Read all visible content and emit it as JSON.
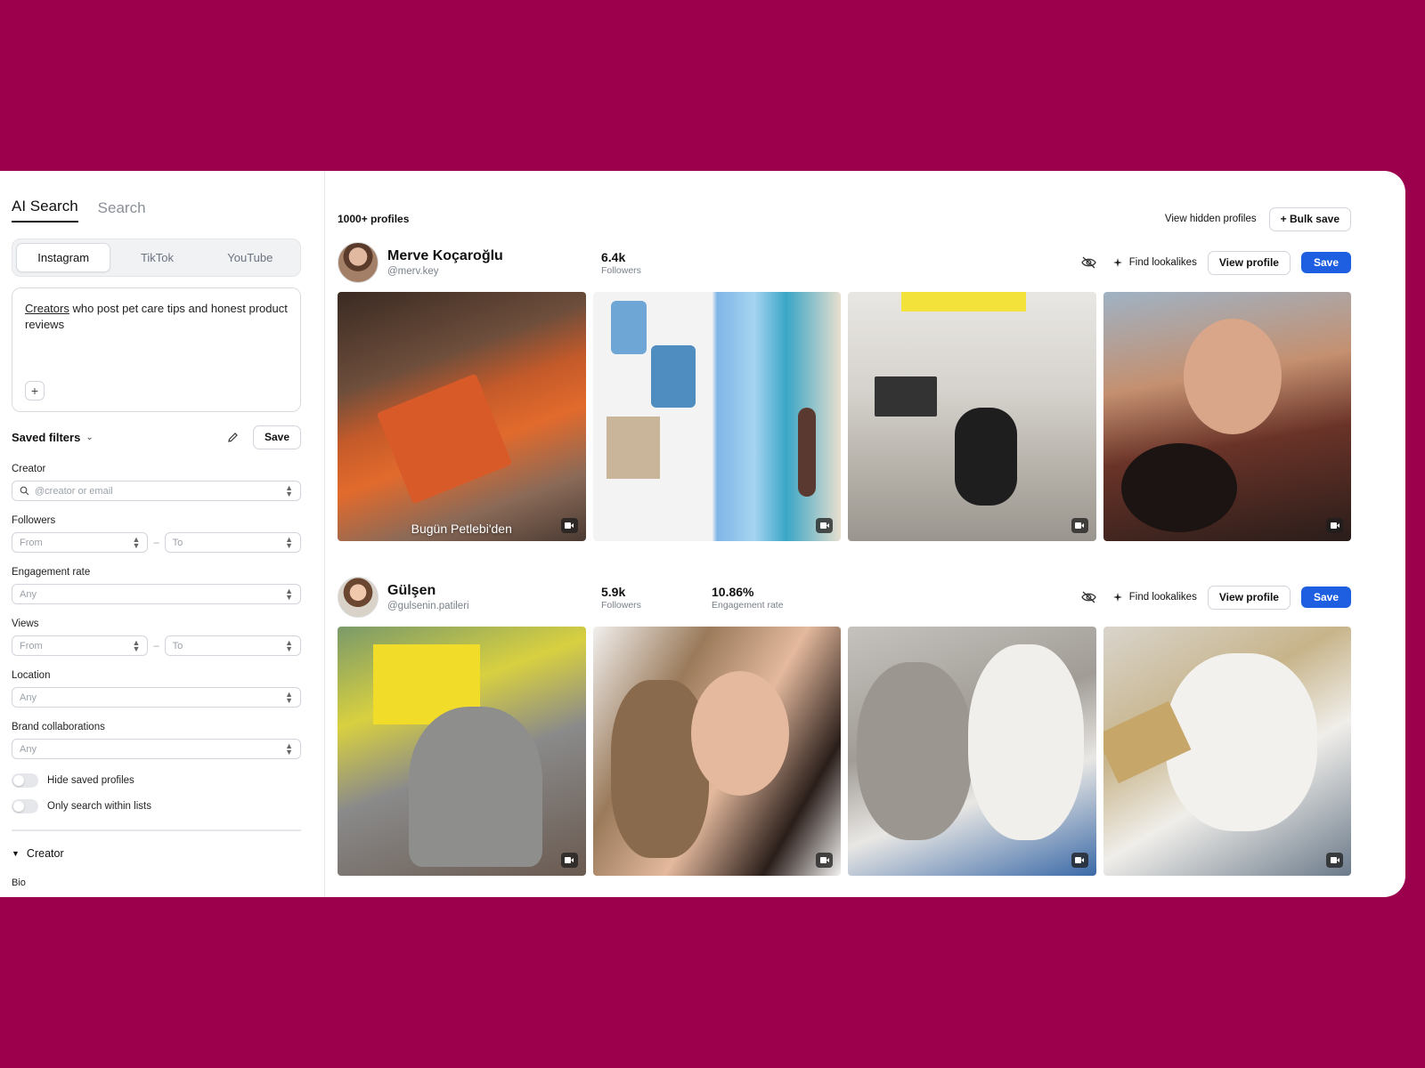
{
  "sidebar": {
    "mode_tabs": [
      {
        "label": "AI Search",
        "active": true
      },
      {
        "label": "Search",
        "active": false
      }
    ],
    "platform_tabs": [
      {
        "label": "Instagram",
        "active": true
      },
      {
        "label": "TikTok",
        "active": false
      },
      {
        "label": "YouTube",
        "active": false
      }
    ],
    "prompt": {
      "underlined_word": "Creators",
      "text": " who post pet care tips and honest product reviews"
    },
    "saved_filters_label": "Saved filters",
    "save_label": "Save",
    "filters": {
      "creator_label": "Creator",
      "creator_placeholder": "@creator or email",
      "followers_label": "Followers",
      "followers_from": "From",
      "followers_to": "To",
      "engagement_label": "Engagement rate",
      "engagement_value": "Any",
      "views_label": "Views",
      "views_from": "From",
      "views_to": "To",
      "location_label": "Location",
      "location_value": "Any",
      "brand_label": "Brand collaborations",
      "brand_value": "Any"
    },
    "toggles": {
      "hide_saved": "Hide saved profiles",
      "only_lists": "Only search within lists"
    },
    "creator_section": "Creator",
    "bio_label": "Bio"
  },
  "main": {
    "count": "1000+ profiles",
    "view_hidden": "View hidden profiles",
    "bulk_save": "+ Bulk save",
    "profiles": [
      {
        "name": "Merve Koçaroğlu",
        "handle": "@merv.key",
        "followers_value": "6.4k",
        "followers_label": "Followers",
        "find_lookalikes": "Find lookalikes",
        "view_profile": "View profile",
        "save": "Save",
        "media_caption": "Bugün Petlebi'den"
      },
      {
        "name": "Gülşen",
        "handle": "@gulsenin.patileri",
        "followers_value": "5.9k",
        "followers_label": "Followers",
        "engagement_value": "10.86%",
        "engagement_label": "Engagement rate",
        "find_lookalikes": "Find lookalikes",
        "view_profile": "View profile",
        "save": "Save"
      }
    ]
  },
  "colors": {
    "background": "#9c004c",
    "primary": "#1d5fe0"
  }
}
